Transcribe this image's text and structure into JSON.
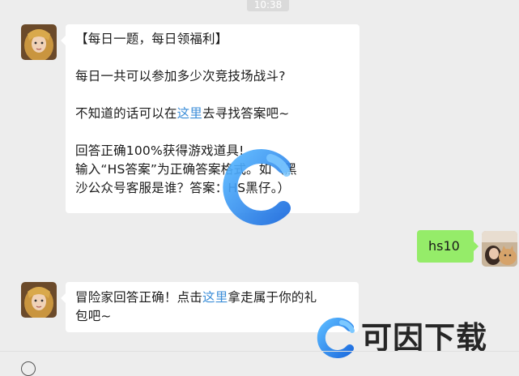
{
  "header": {
    "time": "10:38"
  },
  "messages": [
    {
      "lines": {
        "title": "【每日一题，每日领福利】",
        "question": "每日一共可以参加多少次竞技场战斗?",
        "hint_pre": "不知道的话可以在",
        "hint_link": "这里",
        "hint_post": "去寻找答案吧~",
        "reward_1": "回答正确100%获得游戏道具!",
        "reward_2": "输入“HS答案”为正确答案格式。如（黑",
        "reward_3": "沙公众号客服是谁？答案：HS黑仔。）"
      }
    },
    {
      "text": "hs10"
    },
    {
      "lines": {
        "line1_pre": "冒险家回答正确！点击",
        "line1_link": "这里",
        "line1_post": "拿走属于你的礼",
        "line2": "包吧~"
      }
    }
  ],
  "watermark": {
    "brand": "可因下载"
  },
  "colors": {
    "background": "#ededed",
    "bubble_white": "#ffffff",
    "bubble_green": "#95ec69",
    "link": "#3c8ed8",
    "watermark_blue": "#2f8cf0"
  },
  "icons": [
    "bot-avatar-icon",
    "user-avatar-icon",
    "watermark-logo-icon"
  ]
}
